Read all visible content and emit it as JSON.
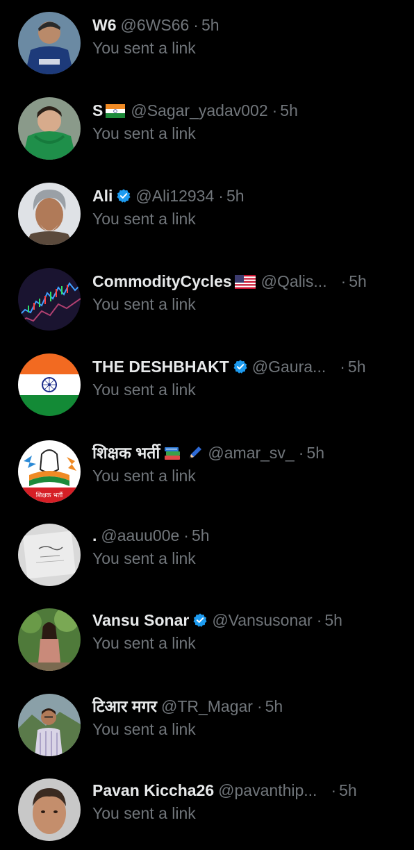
{
  "colors": {
    "background": "#000000",
    "primary_text": "#e7e9ea",
    "secondary_text": "#71767b",
    "verified_blue": "#1d9bf0"
  },
  "messages": [
    {
      "name": "W6",
      "handle": "@6WS66",
      "separator": "·",
      "time": "5h",
      "preview": "You sent a link",
      "avatar": "football-player-avatar"
    },
    {
      "name": "S",
      "flag": "india-flag-icon",
      "handle": "@Sagar_yadav002",
      "separator": "·",
      "time": "5h",
      "preview": "You sent a link",
      "avatar": "green-hoodie-avatar"
    },
    {
      "name": "Ali",
      "verified": true,
      "handle": "@Ali12934",
      "separator": "·",
      "time": "5h",
      "preview": "You sent a link",
      "avatar": "gray-hair-man-avatar"
    },
    {
      "name": "CommodityCycles",
      "flag": "us-flag-icon",
      "handle": "@Qalis...",
      "separator": "·",
      "time": "5h",
      "preview": "You sent a link",
      "avatar": "stock-chart-avatar"
    },
    {
      "name": "THE DESHBHAKT",
      "verified": true,
      "handle": "@Gaura...",
      "separator": "·",
      "time": "5h",
      "preview": "You sent a link",
      "avatar": "india-flag-avatar"
    },
    {
      "name": "शिक्षक भर्ती",
      "emoji": [
        "books-icon",
        "pen-icon"
      ],
      "handle": "@amar_sv_",
      "separator": "·",
      "time": "5h",
      "preview": "You sent a link",
      "avatar": "raised-fist-avatar",
      "avatar_text": "शिक्षक भर्ती"
    },
    {
      "name": ".",
      "handle": "@aauu00e",
      "separator": "·",
      "time": "5h",
      "preview": "You sent a link",
      "avatar": "calligraphy-card-avatar"
    },
    {
      "name": "Vansu Sonar",
      "verified": true,
      "handle": "@Vansusonar",
      "separator": "·",
      "time": "5h",
      "preview": "You sent a link",
      "avatar": "outdoor-person-avatar"
    },
    {
      "name": "टिआर मगर",
      "handle": "@TR_Magar",
      "separator": "·",
      "time": "5h",
      "preview": "You sent a link",
      "avatar": "mountain-man-avatar"
    },
    {
      "name": "Pavan Kiccha26",
      "handle": "@pavanthip...",
      "separator": "·",
      "time": "5h",
      "preview": "You sent a link",
      "avatar": "man-portrait-avatar"
    }
  ]
}
